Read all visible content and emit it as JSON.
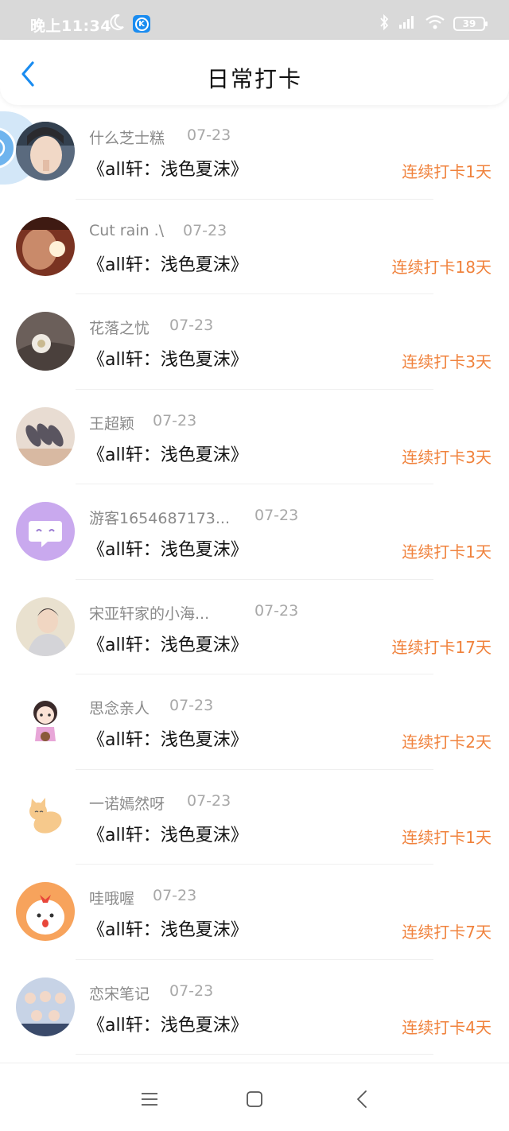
{
  "status_bar": {
    "time": "晚上11:34",
    "battery": "39",
    "app_badge": "K"
  },
  "header": {
    "title": "日常打卡"
  },
  "items": [
    {
      "name": "什么芝士糕",
      "date": "07-23",
      "title": "《all轩：浅色夏沫》",
      "streak": "连续打卡1天"
    },
    {
      "name": "Cut rain .\\",
      "date": "07-23",
      "title": "《all轩：浅色夏沫》",
      "streak": "连续打卡18天"
    },
    {
      "name": "花落之忧",
      "date": "07-23",
      "title": "《all轩：浅色夏沫》",
      "streak": "连续打卡3天"
    },
    {
      "name": "王超颖",
      "date": "07-23",
      "title": "《all轩：浅色夏沫》",
      "streak": "连续打卡3天"
    },
    {
      "name": "游客1654687173...",
      "date": "07-23",
      "title": "《all轩：浅色夏沫》",
      "streak": "连续打卡1天"
    },
    {
      "name": "宋亚轩家的小海...",
      "date": "07-23",
      "title": "《all轩：浅色夏沫》",
      "streak": "连续打卡17天"
    },
    {
      "name": "思念亲人",
      "date": "07-23",
      "title": "《all轩：浅色夏沫》",
      "streak": "连续打卡2天"
    },
    {
      "name": "一诺嫣然呀",
      "date": "07-23",
      "title": "《all轩：浅色夏沫》",
      "streak": "连续打卡1天"
    },
    {
      "name": "哇哦喔",
      "date": "07-23",
      "title": "《all轩：浅色夏沫》",
      "streak": "连续打卡7天"
    },
    {
      "name": "恋宋笔记",
      "date": "07-23",
      "title": "《all轩：浅色夏沫》",
      "streak": "连续打卡4天"
    }
  ],
  "colors": {
    "accent_blue": "#1a8cf0",
    "streak_orange": "#f0823c"
  },
  "icons": {
    "back": "chevron-left-icon",
    "nav_menu": "menu-icon",
    "nav_home": "square-home-icon",
    "nav_back": "triangle-back-icon"
  }
}
